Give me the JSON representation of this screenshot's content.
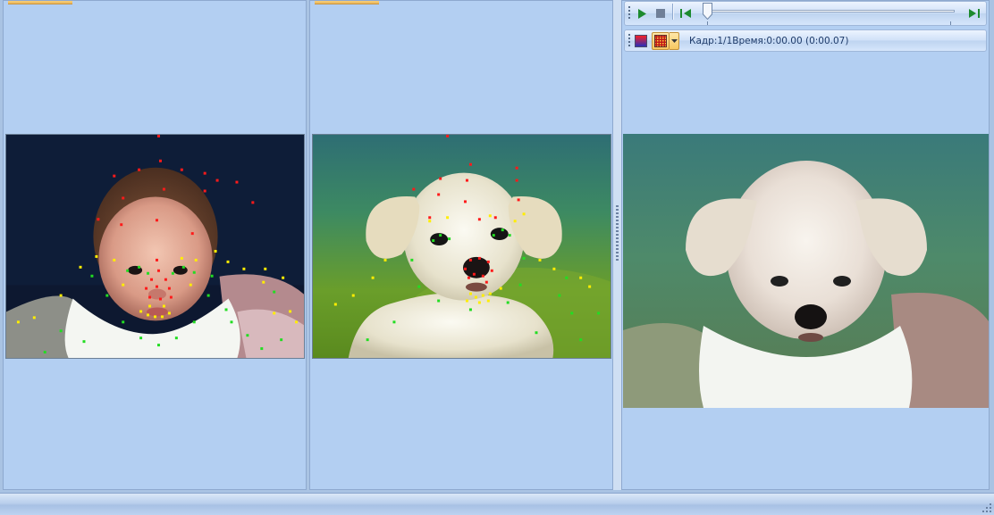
{
  "player_toolbar": {
    "play_icon": "play-icon",
    "stop_icon": "stop-icon",
    "prev_frame_icon": "previous-frame-icon",
    "next_frame_icon": "next-frame-icon",
    "slider_position": 0
  },
  "frame_toolbar": {
    "color_mode_icon": "color-gradient-icon",
    "morph_mode_icon": "morph-pattern-icon",
    "dropdown_icon": "chevron-down-icon",
    "frame_info": "Кадр:1/1Время:0:00.00 (0:00.07)"
  },
  "panels": {
    "source": {
      "image": "baby-face-photo-with-landmarks"
    },
    "target": {
      "image": "puppy-photo-with-landmarks"
    },
    "result": {
      "image": "morphed-baby-puppy-photo"
    }
  },
  "colors": {
    "panel_bg": "#b3cff2",
    "landmark_red": "#ff1a1a",
    "landmark_yellow": "#ffee00",
    "landmark_green": "#22dd22",
    "tab_accent": "#eab65a"
  }
}
